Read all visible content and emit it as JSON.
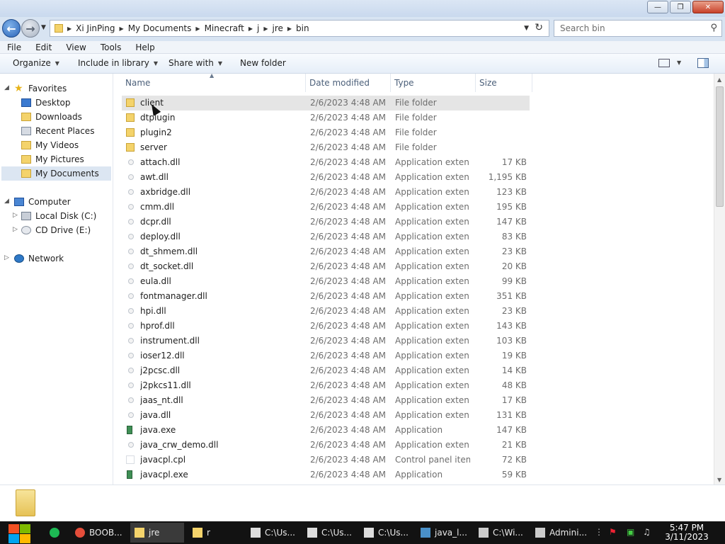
{
  "window": {
    "buttons": {
      "minimize": "—",
      "maximize": "❐",
      "close": "✕"
    }
  },
  "address": {
    "crumbs": [
      "Xi JinPing",
      "My Documents",
      "Minecraft",
      "j",
      "jre",
      "bin"
    ]
  },
  "search": {
    "placeholder": "Search bin"
  },
  "menu": [
    "File",
    "Edit",
    "View",
    "Tools",
    "Help"
  ],
  "commands": {
    "organize": "Organize",
    "include_in_library": "Include in library",
    "share_with": "Share with",
    "new_folder": "New folder"
  },
  "nav": {
    "favorites": "Favorites",
    "desktop": "Desktop",
    "downloads": "Downloads",
    "recent_places": "Recent Places",
    "my_videos": "My Videos",
    "my_pictures": "My Pictures",
    "my_documents": "My Documents",
    "computer": "Computer",
    "local_disk": "Local Disk (C:)",
    "cd_drive": "CD Drive (E:)",
    "network": "Network"
  },
  "columns": {
    "name": "Name",
    "date": "Date modified",
    "type": "Type",
    "size": "Size"
  },
  "files": [
    {
      "name": "client",
      "date": "2/6/2023 4:48 AM",
      "type": "File folder",
      "size": "",
      "kind": "folder"
    },
    {
      "name": "dtplugin",
      "date": "2/6/2023 4:48 AM",
      "type": "File folder",
      "size": "",
      "kind": "folder"
    },
    {
      "name": "plugin2",
      "date": "2/6/2023 4:48 AM",
      "type": "File folder",
      "size": "",
      "kind": "folder"
    },
    {
      "name": "server",
      "date": "2/6/2023 4:48 AM",
      "type": "File folder",
      "size": "",
      "kind": "folder"
    },
    {
      "name": "attach.dll",
      "date": "2/6/2023 4:48 AM",
      "type": "Application exten...",
      "size": "17 KB",
      "kind": "dll"
    },
    {
      "name": "awt.dll",
      "date": "2/6/2023 4:48 AM",
      "type": "Application exten...",
      "size": "1,195 KB",
      "kind": "dll"
    },
    {
      "name": "axbridge.dll",
      "date": "2/6/2023 4:48 AM",
      "type": "Application exten...",
      "size": "123 KB",
      "kind": "dll"
    },
    {
      "name": "cmm.dll",
      "date": "2/6/2023 4:48 AM",
      "type": "Application exten...",
      "size": "195 KB",
      "kind": "dll"
    },
    {
      "name": "dcpr.dll",
      "date": "2/6/2023 4:48 AM",
      "type": "Application exten...",
      "size": "147 KB",
      "kind": "dll"
    },
    {
      "name": "deploy.dll",
      "date": "2/6/2023 4:48 AM",
      "type": "Application exten...",
      "size": "83 KB",
      "kind": "dll"
    },
    {
      "name": "dt_shmem.dll",
      "date": "2/6/2023 4:48 AM",
      "type": "Application exten...",
      "size": "23 KB",
      "kind": "dll"
    },
    {
      "name": "dt_socket.dll",
      "date": "2/6/2023 4:48 AM",
      "type": "Application exten...",
      "size": "20 KB",
      "kind": "dll"
    },
    {
      "name": "eula.dll",
      "date": "2/6/2023 4:48 AM",
      "type": "Application exten...",
      "size": "99 KB",
      "kind": "dll"
    },
    {
      "name": "fontmanager.dll",
      "date": "2/6/2023 4:48 AM",
      "type": "Application exten...",
      "size": "351 KB",
      "kind": "dll"
    },
    {
      "name": "hpi.dll",
      "date": "2/6/2023 4:48 AM",
      "type": "Application exten...",
      "size": "23 KB",
      "kind": "dll"
    },
    {
      "name": "hprof.dll",
      "date": "2/6/2023 4:48 AM",
      "type": "Application exten...",
      "size": "143 KB",
      "kind": "dll"
    },
    {
      "name": "instrument.dll",
      "date": "2/6/2023 4:48 AM",
      "type": "Application exten...",
      "size": "103 KB",
      "kind": "dll"
    },
    {
      "name": "ioser12.dll",
      "date": "2/6/2023 4:48 AM",
      "type": "Application exten...",
      "size": "19 KB",
      "kind": "dll"
    },
    {
      "name": "j2pcsc.dll",
      "date": "2/6/2023 4:48 AM",
      "type": "Application exten...",
      "size": "14 KB",
      "kind": "dll"
    },
    {
      "name": "j2pkcs11.dll",
      "date": "2/6/2023 4:48 AM",
      "type": "Application exten...",
      "size": "48 KB",
      "kind": "dll"
    },
    {
      "name": "jaas_nt.dll",
      "date": "2/6/2023 4:48 AM",
      "type": "Application exten...",
      "size": "17 KB",
      "kind": "dll"
    },
    {
      "name": "java.dll",
      "date": "2/6/2023 4:48 AM",
      "type": "Application exten...",
      "size": "131 KB",
      "kind": "dll"
    },
    {
      "name": "java.exe",
      "date": "2/6/2023 4:48 AM",
      "type": "Application",
      "size": "147 KB",
      "kind": "exe"
    },
    {
      "name": "java_crw_demo.dll",
      "date": "2/6/2023 4:48 AM",
      "type": "Application exten...",
      "size": "21 KB",
      "kind": "dll"
    },
    {
      "name": "javacpl.cpl",
      "date": "2/6/2023 4:48 AM",
      "type": "Control panel item",
      "size": "72 KB",
      "kind": "cpl"
    },
    {
      "name": "javacpl.exe",
      "date": "2/6/2023 4:48 AM",
      "type": "Application",
      "size": "59 KB",
      "kind": "exe"
    }
  ],
  "taskbar": {
    "items": [
      {
        "label": "",
        "icon": "spotify-icon"
      },
      {
        "label": "BOOB...",
        "icon": "chrome-icon"
      },
      {
        "label": "jre",
        "icon": "folder-icon"
      },
      {
        "label": "r",
        "icon": "folder-icon"
      },
      {
        "label": "C:\\Us...",
        "icon": "7zip-icon"
      },
      {
        "label": "C:\\Us...",
        "icon": "7zip-icon"
      },
      {
        "label": "C:\\Us...",
        "icon": "7zip-icon"
      },
      {
        "label": "java_l...",
        "icon": "java-icon"
      },
      {
        "label": "C:\\Wi...",
        "icon": "cmd-icon"
      },
      {
        "label": "Admini...",
        "icon": "cmd-icon"
      }
    ],
    "clock": {
      "time": "5:47 PM",
      "date": "3/11/2023"
    }
  },
  "colors": {
    "folder": "#f4d36b",
    "selection": "#dce6f2",
    "hover": "#e5e5e5",
    "taskbar": "#121212"
  }
}
